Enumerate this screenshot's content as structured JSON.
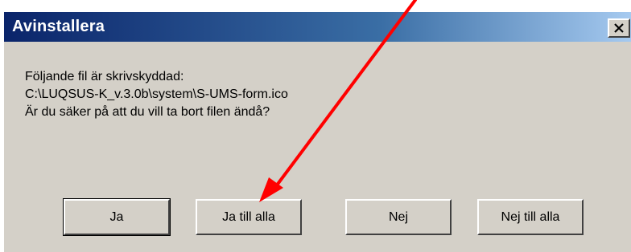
{
  "dialog": {
    "title": "Avinstallera",
    "close_icon": "close-icon",
    "message_lines": [
      "Följande fil är skrivskyddad:",
      "C:\\LUQSUS-K_v.3.0b\\system\\S-UMS-form.ico",
      "Är du säker på att du vill ta bort filen ändå?"
    ],
    "buttons": {
      "yes": "Ja",
      "yes_to_all": "Ja till alla",
      "no": "Nej",
      "no_to_all": "Nej till alla"
    }
  },
  "annotation": {
    "type": "arrow",
    "color": "#ff0000",
    "points_to": "yes_to_all"
  },
  "colors": {
    "titlebar_start": "#0a246a",
    "titlebar_end": "#a6caf0",
    "dialog_face": "#d4d0c8"
  }
}
